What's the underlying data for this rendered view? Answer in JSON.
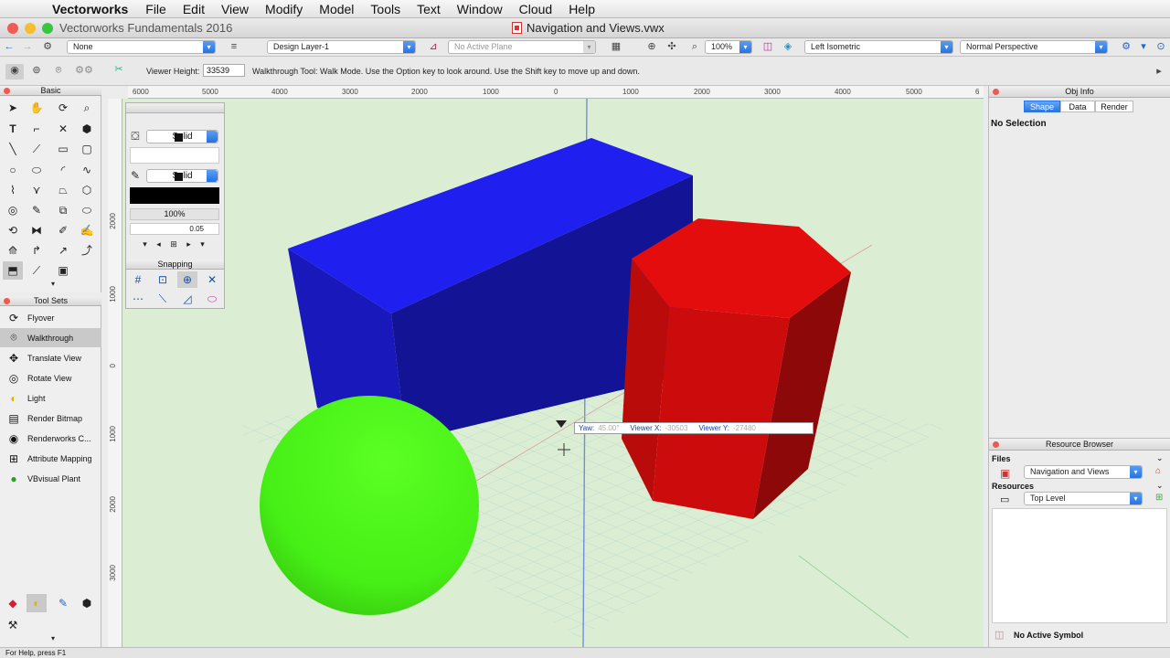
{
  "menubar": {
    "app": "Vectorworks",
    "items": [
      "File",
      "Edit",
      "View",
      "Modify",
      "Model",
      "Tools",
      "Text",
      "Window",
      "Cloud",
      "Help"
    ]
  },
  "window": {
    "app_title": "Vectorworks Fundamentals 2016",
    "doc_title": "Navigation and Views.vwx"
  },
  "viewbar": {
    "class": "None",
    "layer": "Design Layer-1",
    "plane": "No Active Plane",
    "zoom": "100%",
    "view": "Left Isometric",
    "projection": "Normal Perspective"
  },
  "modebar": {
    "height_label": "Viewer Height:",
    "height_value": "33539",
    "help_text": "Walkthrough Tool: Walk Mode. Use the Option key to look around.  Use the Shift key to move up and down."
  },
  "palettes": {
    "basic_title": "Basic",
    "toolsets_title": "Tool Sets",
    "toolsets": [
      {
        "label": "Flyover",
        "icon": "flyover-icon"
      },
      {
        "label": "Walkthrough",
        "icon": "walkthrough-icon",
        "active": true
      },
      {
        "label": "Translate View",
        "icon": "translate-view-icon"
      },
      {
        "label": "Rotate View",
        "icon": "rotate-view-icon"
      },
      {
        "label": "Light",
        "icon": "light-icon"
      },
      {
        "label": "Render Bitmap",
        "icon": "render-bitmap-icon"
      },
      {
        "label": "Renderworks C...",
        "icon": "renderworks-camera-icon"
      },
      {
        "label": "Attribute Mapping",
        "icon": "attribute-mapping-icon"
      },
      {
        "label": "VBvisual Plant",
        "icon": "vbvisual-plant-icon"
      }
    ]
  },
  "attributes": {
    "fill_style": "Solid",
    "pen_style": "Solid",
    "opacity": "100%",
    "line_weight": "0.05",
    "snapping_title": "Snapping"
  },
  "rulers": {
    "h_ticks": [
      "6000",
      "5000",
      "4000",
      "3000",
      "2000",
      "1000",
      "0",
      "1000",
      "2000",
      "3000",
      "4000",
      "5000",
      "6"
    ],
    "v_ticks": [
      "2000",
      "1000",
      "0",
      "1000",
      "2000",
      "3000"
    ]
  },
  "hud": {
    "yaw_label": "Yaw:",
    "yaw_value": "45.00°",
    "vx_label": "Viewer X:",
    "vx_value": "-30503",
    "vy_label": "Viewer Y:",
    "vy_value": "-27480"
  },
  "objinfo": {
    "title": "Obj Info",
    "tabs": [
      "Shape",
      "Data",
      "Render"
    ],
    "selection": "No Selection"
  },
  "resources": {
    "title": "Resource Browser",
    "files_label": "Files",
    "file": "Navigation and Views",
    "resources_label": "Resources",
    "folder": "Top Level",
    "symbol": "No Active Symbol"
  },
  "status": "For Help, press F1",
  "colors": {
    "box_blue": "#1f1ff0",
    "prism_red": "#e30d0d",
    "sphere_green": "#49f51a",
    "ground": "#dbeed3"
  }
}
